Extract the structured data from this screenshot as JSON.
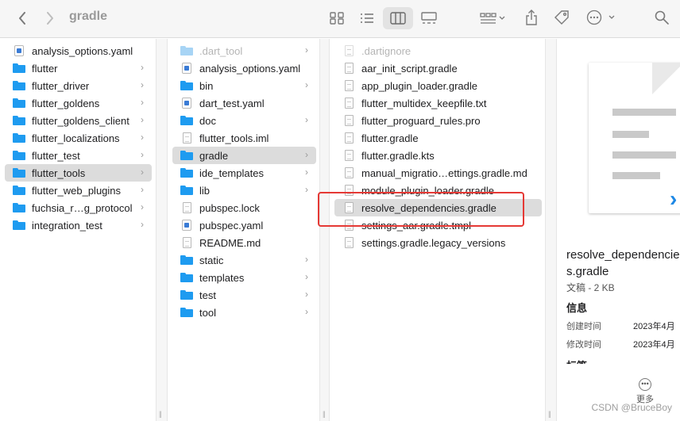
{
  "window": {
    "title": "gradle"
  },
  "icons": {
    "back": "chevron-left-icon",
    "forward": "chevron-right-icon",
    "icon_view": "grid-icon",
    "list_view": "list-icon",
    "column_view": "columns-icon",
    "gallery_view": "gallery-icon",
    "group": "group-icon",
    "share": "share-icon",
    "tag": "tag-icon",
    "more": "ellipsis-icon",
    "search": "search-icon"
  },
  "column1": {
    "items": [
      {
        "label": "analysis_options.yaml",
        "kind": "yaml"
      },
      {
        "label": "flutter",
        "kind": "folder",
        "chevron": "›"
      },
      {
        "label": "flutter_driver",
        "kind": "folder",
        "chevron": "›"
      },
      {
        "label": "flutter_goldens",
        "kind": "folder",
        "chevron": "›"
      },
      {
        "label": "flutter_goldens_client",
        "kind": "folder",
        "chevron": "›"
      },
      {
        "label": "flutter_localizations",
        "kind": "folder",
        "chevron": "›"
      },
      {
        "label": "flutter_test",
        "kind": "folder",
        "chevron": "›"
      },
      {
        "label": "flutter_tools",
        "kind": "folder",
        "chevron": "›",
        "selected": true
      },
      {
        "label": "flutter_web_plugins",
        "kind": "folder",
        "chevron": "›"
      },
      {
        "label": "fuchsia_r…g_protocol",
        "kind": "folder",
        "chevron": "›"
      },
      {
        "label": "integration_test",
        "kind": "folder",
        "chevron": "›"
      }
    ]
  },
  "column2": {
    "items": [
      {
        "label": ".dart_tool",
        "kind": "folder-dim",
        "chevron": "›"
      },
      {
        "label": "analysis_options.yaml",
        "kind": "yaml"
      },
      {
        "label": "bin",
        "kind": "folder",
        "chevron": "›"
      },
      {
        "label": "dart_test.yaml",
        "kind": "yaml"
      },
      {
        "label": "doc",
        "kind": "folder",
        "chevron": "›"
      },
      {
        "label": "flutter_tools.iml",
        "kind": "doc"
      },
      {
        "label": "gradle",
        "kind": "folder",
        "chevron": "›",
        "selected": true
      },
      {
        "label": "ide_templates",
        "kind": "folder",
        "chevron": "›"
      },
      {
        "label": "lib",
        "kind": "folder",
        "chevron": "›"
      },
      {
        "label": "pubspec.lock",
        "kind": "doc"
      },
      {
        "label": "pubspec.yaml",
        "kind": "yaml"
      },
      {
        "label": "README.md",
        "kind": "doc"
      },
      {
        "label": "static",
        "kind": "folder",
        "chevron": "›"
      },
      {
        "label": "templates",
        "kind": "folder",
        "chevron": "›"
      },
      {
        "label": "test",
        "kind": "folder",
        "chevron": "›"
      },
      {
        "label": "tool",
        "kind": "folder",
        "chevron": "›"
      }
    ]
  },
  "column3": {
    "items": [
      {
        "label": ".dartignore",
        "kind": "doc-dim"
      },
      {
        "label": "aar_init_script.gradle",
        "kind": "doc"
      },
      {
        "label": "app_plugin_loader.gradle",
        "kind": "doc"
      },
      {
        "label": "flutter_multidex_keepfile.txt",
        "kind": "doc"
      },
      {
        "label": "flutter_proguard_rules.pro",
        "kind": "doc"
      },
      {
        "label": "flutter.gradle",
        "kind": "doc"
      },
      {
        "label": "flutter.gradle.kts",
        "kind": "doc"
      },
      {
        "label": "manual_migratio…ettings.gradle.md",
        "kind": "doc"
      },
      {
        "label": "module_plugin_loader.gradle",
        "kind": "doc"
      },
      {
        "label": "resolve_dependencies.gradle",
        "kind": "doc",
        "selected": true
      },
      {
        "label": "settings_aar.gradle.tmpl",
        "kind": "doc"
      },
      {
        "label": "settings.gradle.legacy_versions",
        "kind": "doc"
      }
    ]
  },
  "preview": {
    "name": "resolve_dependencies.gradle",
    "kind_size": "文稿 - 2 KB",
    "info_heading": "信息",
    "created_label": "创建时间",
    "created_value": "2023年4月",
    "modified_label": "修改时间",
    "modified_value": "2023年4月",
    "tags_heading": "标签",
    "more_label": "更多"
  },
  "watermark": "CSDN @BruceBoy",
  "colors": {
    "folder": "#1e9bf0",
    "selection": "#dcdcdc",
    "annotation": "#e53935"
  }
}
